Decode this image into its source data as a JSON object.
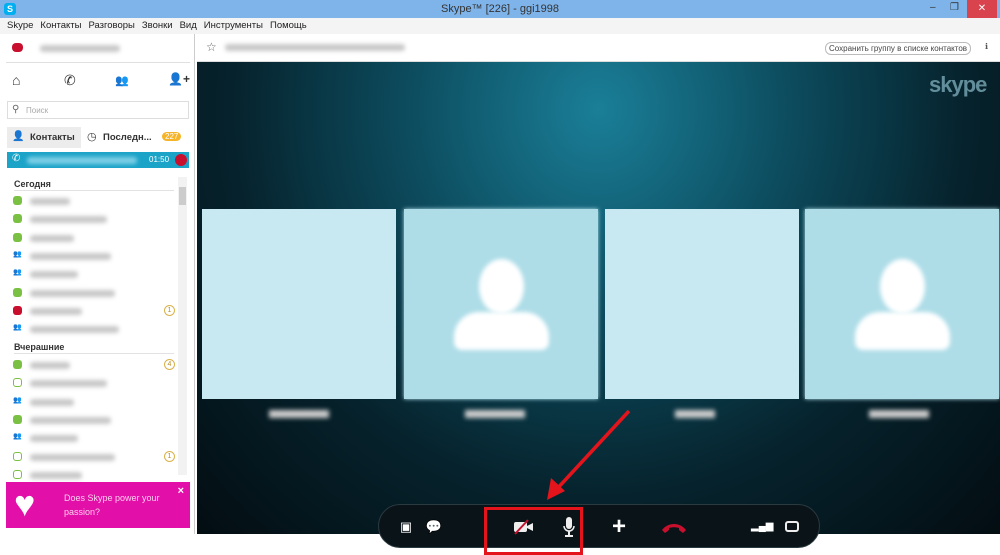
{
  "window": {
    "title": "Skype™ [226] - ggi1998",
    "minimize": "–",
    "restore": "❐",
    "close": "✕"
  },
  "menu": [
    "Skype",
    "Контакты",
    "Разговоры",
    "Звонки",
    "Вид",
    "Инструменты",
    "Помощь"
  ],
  "sidebar": {
    "search_placeholder": "Поиск",
    "tabs": {
      "contacts": "Контакты",
      "recent": "Последн...",
      "recent_count": "227"
    },
    "active_call": {
      "time": "01:50"
    },
    "sections": {
      "today": "Сегодня",
      "yesterday": "Вчерашние"
    },
    "today_rows": [
      {
        "status": "online"
      },
      {
        "status": "online"
      },
      {
        "status": "online"
      },
      {
        "status": "group"
      },
      {
        "status": "group"
      },
      {
        "status": "online"
      },
      {
        "status": "dnd",
        "badge": "1"
      },
      {
        "status": "group"
      }
    ],
    "yesterday_rows": [
      {
        "status": "online",
        "badge": "4"
      },
      {
        "status": "offline"
      },
      {
        "status": "group"
      },
      {
        "status": "online"
      },
      {
        "status": "group"
      },
      {
        "status": "offline",
        "badge": "1"
      },
      {
        "status": "offline"
      }
    ],
    "promo": {
      "text": "Does Skype power your passion?",
      "close": "×"
    }
  },
  "header": {
    "save_group": "Сохранить группу в списке контактов"
  },
  "video": {
    "logo": "skype"
  },
  "colors": {
    "online": "#7ac143",
    "dnd": "#c8102e",
    "accent": "#00aff0",
    "promo": "#e20fa8",
    "highlight": "#e3141c"
  }
}
